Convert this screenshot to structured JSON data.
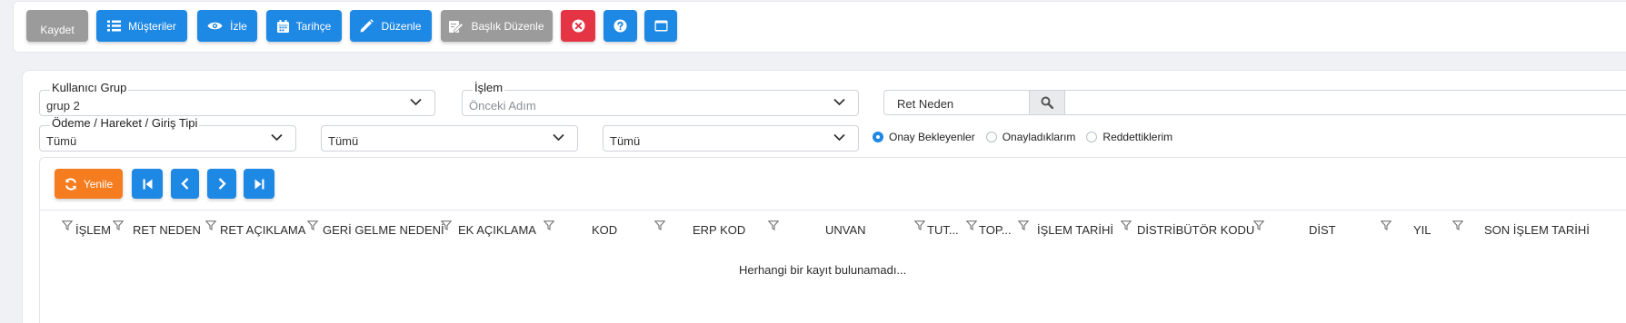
{
  "toolbar": {
    "save_label": "Kaydet",
    "customers_label": "Müşteriler",
    "watch_label": "İzle",
    "history_label": "Tarihçe",
    "edit_label": "Düzenle",
    "header_edit_label": "Başlık Düzenle"
  },
  "filters": {
    "user_group": {
      "label": "Kullanıcı Grup",
      "value": "grup 2"
    },
    "operation": {
      "label": "İşlem",
      "value": "Önceki Adım"
    },
    "payment_type": {
      "label": "Ödeme / Hareket / Giriş Tipi",
      "value": "Tümü"
    },
    "filter2": {
      "value": "Tümü"
    },
    "filter3": {
      "value": "Tümü"
    },
    "search": {
      "value": "Ret Neden"
    },
    "radios": [
      {
        "label": "Onay Bekleyenler",
        "checked": true
      },
      {
        "label": "Onayladıklarım",
        "checked": false
      },
      {
        "label": "Reddettiklerim",
        "checked": false
      }
    ]
  },
  "grid": {
    "refresh_label": "Yenile",
    "columns": [
      "İŞLEM",
      "RET NEDEN",
      "RET AÇIKLAMA",
      "GERİ GELME NEDENİ",
      "EK AÇIKLAMA",
      "KOD",
      "ERP KOD",
      "UNVAN",
      "TUT...",
      "TOP...",
      "İŞLEM TARİHİ",
      "DİSTRİBÜTÖR KODU",
      "DİST",
      "YIL",
      "SON İŞLEM TARİHİ"
    ],
    "empty_message": "Herhangi bir kayıt bulunamadı..."
  },
  "colors": {
    "primary": "#1e88e5",
    "danger": "#e53545",
    "secondary": "#9b9b9b",
    "accent": "#f57c1f"
  }
}
